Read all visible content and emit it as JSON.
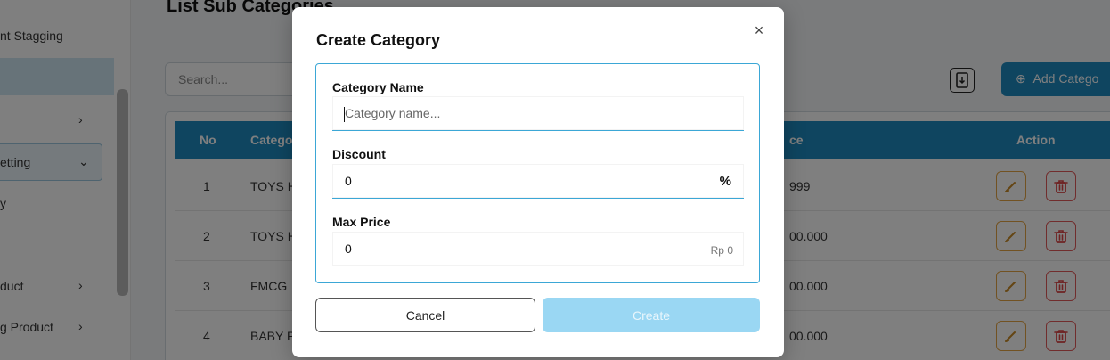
{
  "sidebar": {
    "items": [
      {
        "label": "nt Stagging"
      },
      {
        "label": ""
      },
      {
        "label": ""
      },
      {
        "label": "etting"
      },
      {
        "label": "y"
      },
      {
        "label": "duct"
      },
      {
        "label": "g Product"
      }
    ]
  },
  "main": {
    "page_title": "List Sub Categories",
    "search_placeholder": "Search...",
    "add_button_label": "Add Catego",
    "table": {
      "headers": {
        "no": "No",
        "category": "Catego",
        "price": "ce",
        "action": "Action"
      },
      "rows": [
        {
          "no": "1",
          "category": "TOYS H",
          "price": "999"
        },
        {
          "no": "2",
          "category": "TOYS H",
          "price": "00.000"
        },
        {
          "no": "3",
          "category": "FMCG",
          "price": "00.000"
        },
        {
          "no": "4",
          "category": "BABY P",
          "price": "00.000"
        }
      ]
    }
  },
  "modal": {
    "title": "Create Category",
    "close_symbol": "×",
    "fields": {
      "category_name": {
        "label": "Category Name",
        "value": "",
        "placeholder": "Category name..."
      },
      "discount": {
        "label": "Discount",
        "value": "0",
        "suffix": "%"
      },
      "max_price": {
        "label": "Max Price",
        "value": "0",
        "suffix": "Rp 0"
      }
    },
    "cancel_label": "Cancel",
    "create_label": "Create"
  },
  "colors": {
    "accent": "#1f8bc1",
    "focus_border": "#3ba7d6",
    "create_disabled": "#9ad7f3",
    "edit_icon": "#e5a544",
    "delete_icon": "#e25b5b"
  }
}
